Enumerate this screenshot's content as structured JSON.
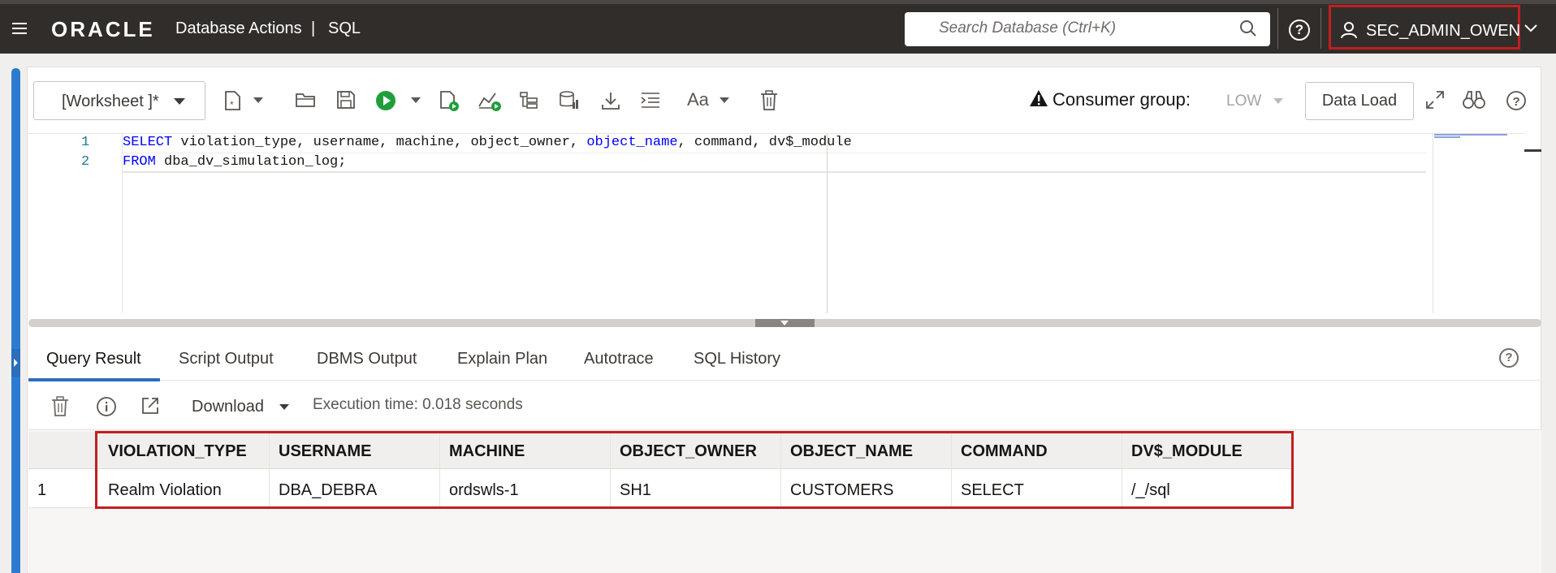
{
  "header": {
    "logo": "ORACLE",
    "app_title": "Database Actions",
    "separator": "|",
    "page": "SQL",
    "search_placeholder": "Search Database (Ctrl+K)",
    "help": "?",
    "user": "SEC_ADMIN_OWEN"
  },
  "toolbar": {
    "worksheet": "[Worksheet ]*",
    "font_label": "Aa",
    "consumer_group_label": "Consumer group:",
    "consumer_group_value": "LOW",
    "data_load": "Data Load"
  },
  "editor": {
    "line_numbers": [
      "1",
      "2"
    ],
    "line1": {
      "kw": "SELECT",
      "part1": " violation_type, username, machine, object_owner, ",
      "fn": "object_name",
      "part2": ", command, dv$_module"
    },
    "line2": {
      "kw": "FROM",
      "part1": " dba_dv_simulation_log;"
    }
  },
  "result_tabs": [
    "Query Result",
    "Script Output",
    "DBMS Output",
    "Explain Plan",
    "Autotrace",
    "SQL History"
  ],
  "result_toolbar": {
    "download": "Download",
    "execution_time": "Execution time: 0.018 seconds"
  },
  "grid": {
    "columns": [
      "VIOLATION_TYPE",
      "USERNAME",
      "MACHINE",
      "OBJECT_OWNER",
      "OBJECT_NAME",
      "COMMAND",
      "DV$_MODULE"
    ],
    "rows": [
      {
        "num": "1",
        "cells": [
          "Realm Violation",
          "DBA_DEBRA",
          "ordswls-1",
          "SH1",
          "CUSTOMERS",
          "SELECT",
          "/_/sql"
        ]
      }
    ]
  },
  "colors": {
    "topbar": "#312d2a",
    "accent_blue": "#2a6fba",
    "highlight_red": "#c21f20",
    "run_green": "#1f9e3a"
  }
}
